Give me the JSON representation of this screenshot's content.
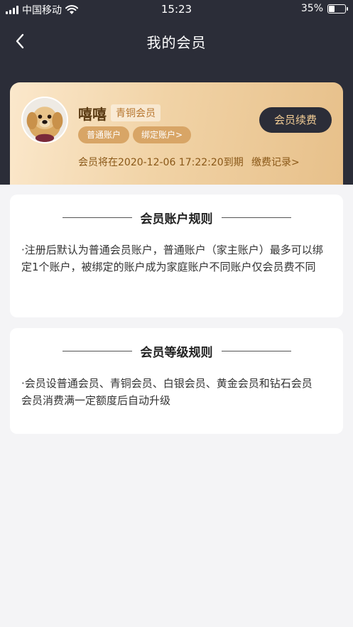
{
  "status_bar": {
    "carrier": "中国移动",
    "time": "15:23",
    "battery": "35%"
  },
  "nav": {
    "title": "我的会员"
  },
  "member": {
    "name": "嘻嘻",
    "level": "青铜会员",
    "account_type": "普通账户",
    "bind_account": "绑定账户>",
    "renew_label": "会员续费",
    "expire_text": "会员将在2020-12-06 17:22:20到期",
    "fee_record": "缴费记录>"
  },
  "account_rules": {
    "title": "会员账户规则",
    "text": "·注册后默认为普通会员账户，普通账户（家主账户）最多可以绑定1个账户，被绑定的账户成为家庭账户不同账户仅会员费不同"
  },
  "level_rules": {
    "title": "会员等级规则",
    "text": "·会员设普通会员、青铜会员、白银会员、黄金会员和钻石会员　会员消费满一定额度后自动升级"
  },
  "colors": {
    "header_bg": "#2b2d38",
    "card_gold": "#f1d3a6",
    "accent_brown": "#8a5818",
    "renew_text": "#f3cd95"
  }
}
